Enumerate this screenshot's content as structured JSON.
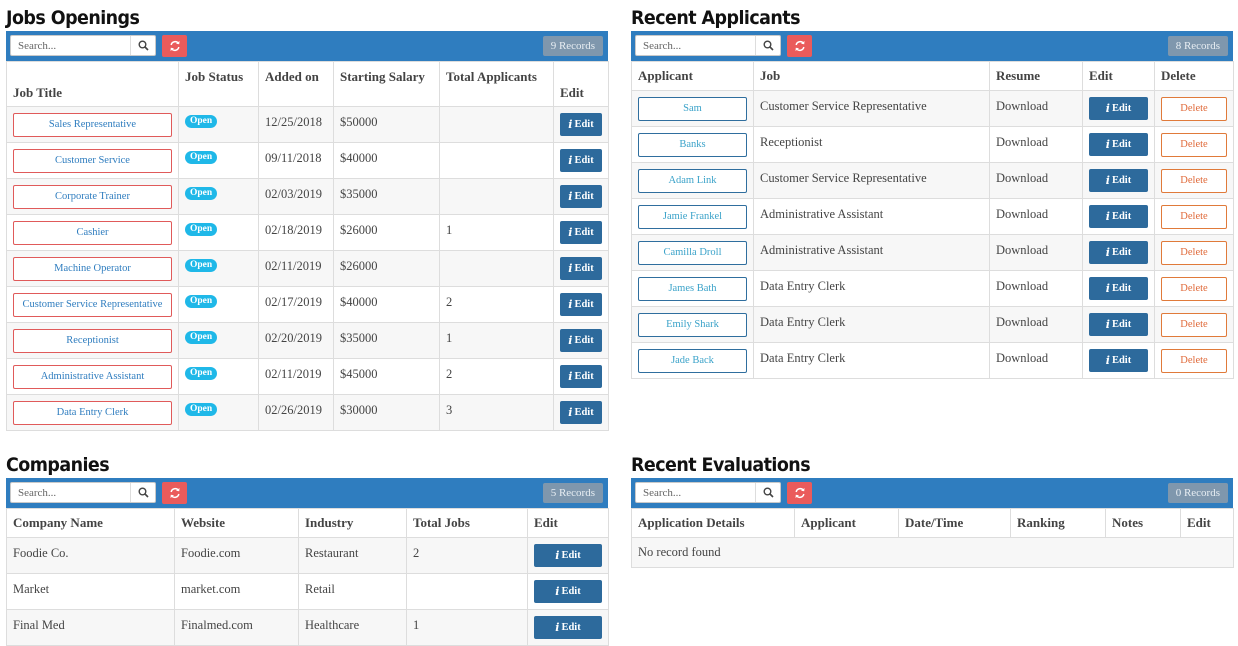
{
  "jobs": {
    "title": "Jobs Openings",
    "search_placeholder": "Search...",
    "records": "9 Records",
    "headers": {
      "title": "Job Title",
      "status": "Job Status",
      "added": "Added on",
      "salary": "Starting Salary",
      "applicants": "Total Applicants",
      "edit": "Edit"
    },
    "edit_label": "Edit",
    "rows": [
      {
        "title": "Sales Representative",
        "status": "Open",
        "added": "12/25/2018",
        "salary": "$50000",
        "applicants": ""
      },
      {
        "title": "Customer Service",
        "status": "Open",
        "added": "09/11/2018",
        "salary": "$40000",
        "applicants": ""
      },
      {
        "title": "Corporate Trainer",
        "status": "Open",
        "added": "02/03/2019",
        "salary": "$35000",
        "applicants": ""
      },
      {
        "title": "Cashier",
        "status": "Open",
        "added": "02/18/2019",
        "salary": "$26000",
        "applicants": "1"
      },
      {
        "title": "Machine Operator",
        "status": "Open",
        "added": "02/11/2019",
        "salary": "$26000",
        "applicants": ""
      },
      {
        "title": "Customer Service Representative",
        "status": "Open",
        "added": "02/17/2019",
        "salary": "$40000",
        "applicants": "2"
      },
      {
        "title": "Receptionist",
        "status": "Open",
        "added": "02/20/2019",
        "salary": "$35000",
        "applicants": "1"
      },
      {
        "title": "Administrative Assistant",
        "status": "Open",
        "added": "02/11/2019",
        "salary": "$45000",
        "applicants": "2"
      },
      {
        "title": "Data Entry Clerk",
        "status": "Open",
        "added": "02/26/2019",
        "salary": "$30000",
        "applicants": "3"
      }
    ]
  },
  "applicants": {
    "title": "Recent Applicants",
    "search_placeholder": "Search...",
    "records": "8 Records",
    "headers": {
      "applicant": "Applicant",
      "job": "Job",
      "resume": "Resume",
      "edit": "Edit",
      "delete": "Delete"
    },
    "edit_label": "Edit",
    "delete_label": "Delete",
    "rows": [
      {
        "applicant": "Sam",
        "job": "Customer Service Representative",
        "resume": "Download"
      },
      {
        "applicant": "Banks",
        "job": "Receptionist",
        "resume": "Download"
      },
      {
        "applicant": "Adam Link",
        "job": "Customer Service Representative",
        "resume": "Download"
      },
      {
        "applicant": "Jamie Frankel",
        "job": "Administrative Assistant",
        "resume": "Download"
      },
      {
        "applicant": "Camilla Droll",
        "job": "Administrative Assistant",
        "resume": "Download"
      },
      {
        "applicant": "James Bath",
        "job": "Data Entry Clerk",
        "resume": "Download"
      },
      {
        "applicant": "Emily Shark",
        "job": "Data Entry Clerk",
        "resume": "Download"
      },
      {
        "applicant": "Jade Back",
        "job": "Data Entry Clerk",
        "resume": "Download"
      }
    ]
  },
  "companies": {
    "title": "Companies",
    "search_placeholder": "Search...",
    "records": "5 Records",
    "headers": {
      "name": "Company Name",
      "website": "Website",
      "industry": "Industry",
      "jobs": "Total Jobs",
      "edit": "Edit"
    },
    "edit_label": "Edit",
    "rows": [
      {
        "name": "Foodie Co.",
        "website": "Foodie.com",
        "industry": "Restaurant",
        "jobs": "2"
      },
      {
        "name": "Market",
        "website": "market.com",
        "industry": "Retail",
        "jobs": ""
      },
      {
        "name": "Final Med",
        "website": "Finalmed.com",
        "industry": "Healthcare",
        "jobs": "1"
      }
    ]
  },
  "evaluations": {
    "title": "Recent Evaluations",
    "search_placeholder": "Search...",
    "records": "0 Records",
    "headers": {
      "details": "Application Details",
      "applicant": "Applicant",
      "datetime": "Date/Time",
      "ranking": "Ranking",
      "notes": "Notes",
      "edit": "Edit"
    },
    "empty": "No record found"
  }
}
